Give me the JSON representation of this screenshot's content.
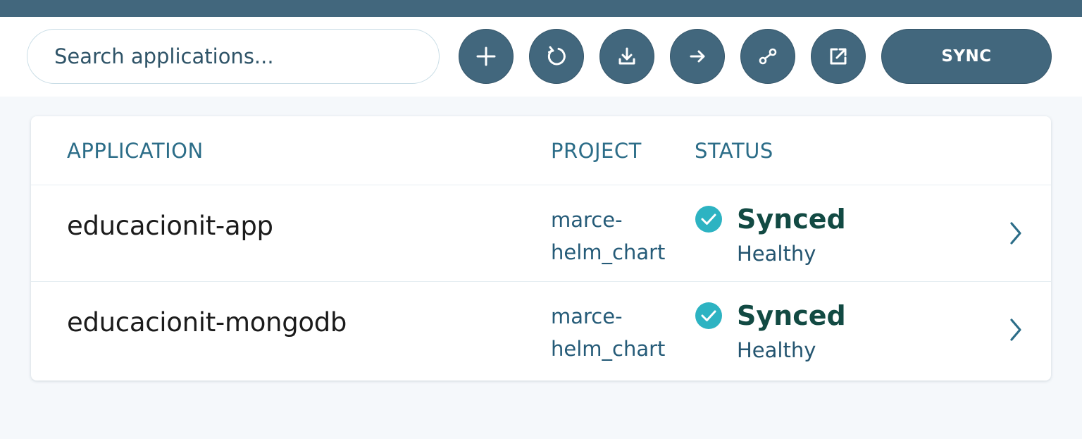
{
  "search": {
    "placeholder": "Search applications..."
  },
  "toolbar": {
    "buttons": [
      {
        "icon": "plus-icon"
      },
      {
        "icon": "refresh-icon"
      },
      {
        "icon": "download-icon"
      },
      {
        "icon": "arrow-right-icon"
      },
      {
        "icon": "link-icon"
      },
      {
        "icon": "external-link-icon"
      }
    ],
    "sync_label": "SYNC"
  },
  "table": {
    "headers": {
      "application": "APPLICATION",
      "project": "PROJECT",
      "status": "STATUS"
    },
    "rows": [
      {
        "application": "educacionit-app",
        "project": "marce-\nhelm_chart",
        "sync": "Synced",
        "health": "Healthy"
      },
      {
        "application": "educacionit-mongodb",
        "project": "marce-\nhelm_chart",
        "sync": "Synced",
        "health": "Healthy"
      }
    ]
  },
  "colors": {
    "topbar": "#42677d",
    "button": "#42677d",
    "status_check": "#2db3c2",
    "synced_text": "#124a43",
    "header_text": "#2c6d88"
  }
}
